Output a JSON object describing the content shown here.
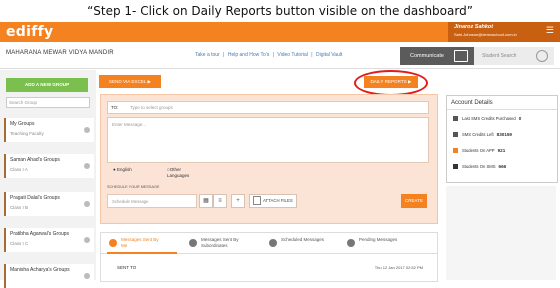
{
  "caption": "“Step 1- Click on Daily Reports button visible on the dashboard”",
  "header": {
    "logo": "ediffy",
    "user_name": "Jinaroz Sahkot",
    "user_email": "Sahi.Johnson@demoschool.com.in"
  },
  "nav": {
    "school_name": "MAHARANA MEWAR VIDYA MANDIR",
    "links": [
      "Take a tour",
      "|",
      "Help and How To's",
      "|",
      "Video Tutorial",
      "|",
      "Digital Vault"
    ],
    "communicate_label": "Communicate",
    "student_search_label": "Student Search"
  },
  "sidebar": {
    "add_group_label": "ADD A NEW GROUP",
    "search_placeholder": "Search Group",
    "groups": [
      {
        "name": "My Groups",
        "sub": "Teaching Faculty"
      },
      {
        "name": "Saman Ahad's Groups",
        "sub": "Class I A"
      },
      {
        "name": "Pragati Dalal's Groups",
        "sub": "Class I B"
      },
      {
        "name": "Pratibha Agarwal's Groups",
        "sub": "Class I C"
      },
      {
        "name": "Manisha Acharya's Groups",
        "sub": ""
      }
    ]
  },
  "actions": {
    "send_excel_label": "SEND VIA EXCEL ▶",
    "daily_reports_label": "DAILY REPORTS ▶"
  },
  "composer": {
    "to_label": "TO:",
    "to_placeholder": "Type to select groups",
    "message_placeholder": "Enter Message...",
    "lang_english": "English",
    "lang_other": "Other Languages",
    "schedule_label": "SCHEDULE YOUR MESSAGE",
    "schedule_placeholder": "Schedule Message",
    "attach_label": "ATTACH FILES",
    "create_label": "CREATE"
  },
  "account": {
    "title": "Account Details",
    "rows": [
      {
        "label": "Last SMS Credits Purchased",
        "value": "0",
        "color": "#555555"
      },
      {
        "label": "SMS Credits Left",
        "value": "830159",
        "color": "#555555"
      },
      {
        "label": "Students On APP",
        "value": "921",
        "color": "#f58220"
      },
      {
        "label": "Students On SMS",
        "value": "666",
        "color": "#333333"
      }
    ]
  },
  "tabs": {
    "items": [
      {
        "label": "Messages Sent By Me",
        "color": "#f58220"
      },
      {
        "label": "Messages Sent By Subordinates",
        "color": "#777777"
      },
      {
        "label": "Scheduled Messages",
        "color": "#777777"
      },
      {
        "label": "Pending Messages",
        "color": "#777777"
      }
    ],
    "sent_to_label": "SENT TO",
    "date": "Thu 12 Jan 2017 02:52 PM"
  }
}
